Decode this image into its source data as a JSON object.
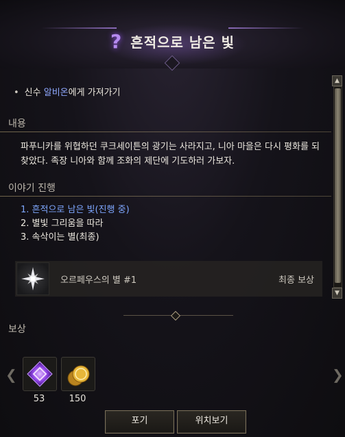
{
  "header": {
    "title": "흔적으로 남은 빛",
    "icon": "question-mark-icon",
    "accent": "#b58af0"
  },
  "objective": {
    "bullet": "•",
    "prefix": "신수 ",
    "npc": "알비온",
    "suffix": "에게 가져가기"
  },
  "content": {
    "title": "내용",
    "text": "파푸니카를 위협하던 쿠크세이튼의 광기는 사라지고, 니아 마을은 다시 평화를 되찾았다. 족장 니아와 함께 조화의 제단에 기도하러 가보자."
  },
  "story": {
    "title": "이야기 진행",
    "steps": [
      "1. 흔적으로 남은 빛(진행 중)",
      "2. 별빛 그리움을 따라",
      "3. 속삭이는 별(최종)"
    ]
  },
  "final_reward": {
    "icon": "star-icon",
    "name": "오르페우스의 별 #1",
    "label": "최종 보상"
  },
  "rewards": {
    "title": "보상",
    "items": [
      {
        "icon": "purple-gem-icon",
        "count": "53"
      },
      {
        "icon": "gold-coins-icon",
        "count": "150"
      }
    ]
  },
  "buttons": {
    "give_up": "포기",
    "locate": "위치보기"
  }
}
